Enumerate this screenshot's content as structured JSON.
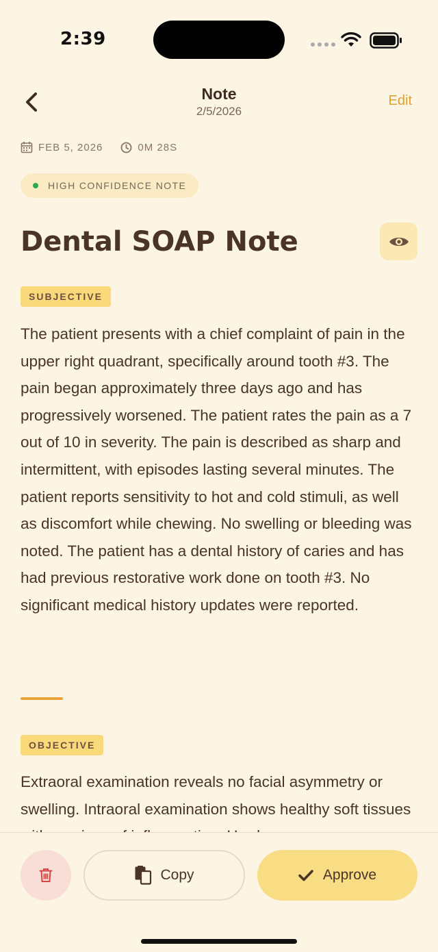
{
  "status_bar": {
    "time": "2:39"
  },
  "header": {
    "title": "Note",
    "subtitle": "2/5/2026",
    "edit_label": "Edit"
  },
  "meta": {
    "date": "FEB 5, 2026",
    "duration": "0M 28S"
  },
  "confidence": {
    "label": "HIGH CONFIDENCE NOTE",
    "color": "#2EA84A"
  },
  "note": {
    "title": "Dental SOAP Note",
    "sections": [
      {
        "tag": "SUBJECTIVE",
        "text": "The patient presents with a chief complaint of pain in the upper right quadrant, specifically around tooth #3. The pain began approximately three days ago and has progressively worsened. The patient rates the pain as a 7 out of 10 in severity. The pain is described as sharp and intermittent, with episodes lasting several minutes. The patient reports sensitivity to hot and cold stimuli, as well as discomfort while chewing. No swelling or bleeding was noted. The patient has a dental history of caries and has had previous restorative work done on tooth #3. No significant medical history updates were reported."
      },
      {
        "tag": "OBJECTIVE",
        "text": "Extraoral examination reveals no facial asymmetry or swelling. Intraoral examination shows healthy soft tissues with no signs of inflammation. Hard"
      }
    ]
  },
  "actions": {
    "copy_label": "Copy",
    "approve_label": "Approve"
  },
  "colors": {
    "background": "#FDF5E4",
    "accent": "#E0A030",
    "tag": "#F9D97A",
    "approve": "#F9DD85",
    "delete": "#F8DED6",
    "delete_icon": "#D64545"
  },
  "icons": {
    "back": "chevron-left-icon",
    "calendar": "calendar-icon",
    "clock": "clock-icon",
    "eye": "eye-icon",
    "trash": "trash-icon",
    "copy": "copy-icon",
    "check": "check-icon"
  }
}
